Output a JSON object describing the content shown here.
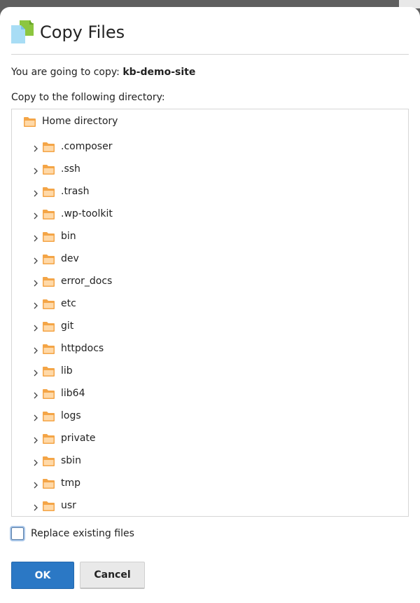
{
  "dialog": {
    "title": "Copy Files",
    "copy_prefix": "You are going to copy:",
    "copy_target": "kb-demo-site",
    "directory_label": "Copy to the following directory:"
  },
  "tree": {
    "root_label": "Home directory",
    "items": [
      {
        "label": ".composer"
      },
      {
        "label": ".ssh"
      },
      {
        "label": ".trash"
      },
      {
        "label": ".wp-toolkit"
      },
      {
        "label": "bin"
      },
      {
        "label": "dev"
      },
      {
        "label": "error_docs"
      },
      {
        "label": "etc"
      },
      {
        "label": "git"
      },
      {
        "label": "httpdocs"
      },
      {
        "label": "lib"
      },
      {
        "label": "lib64"
      },
      {
        "label": "logs"
      },
      {
        "label": "private"
      },
      {
        "label": "sbin"
      },
      {
        "label": "tmp"
      },
      {
        "label": "usr"
      }
    ]
  },
  "options": {
    "replace_label": "Replace existing files",
    "replace_checked": false
  },
  "buttons": {
    "ok_label": "OK",
    "cancel_label": "Cancel"
  },
  "colors": {
    "accent": "#2b78c5",
    "folder": "#f4a547",
    "title_icon_green": "#8cc63f",
    "title_icon_blue": "#a8ddf5"
  },
  "icons": {
    "title": "copy-files-icon",
    "folder": "folder-icon",
    "expand": "chevron-right-icon"
  }
}
